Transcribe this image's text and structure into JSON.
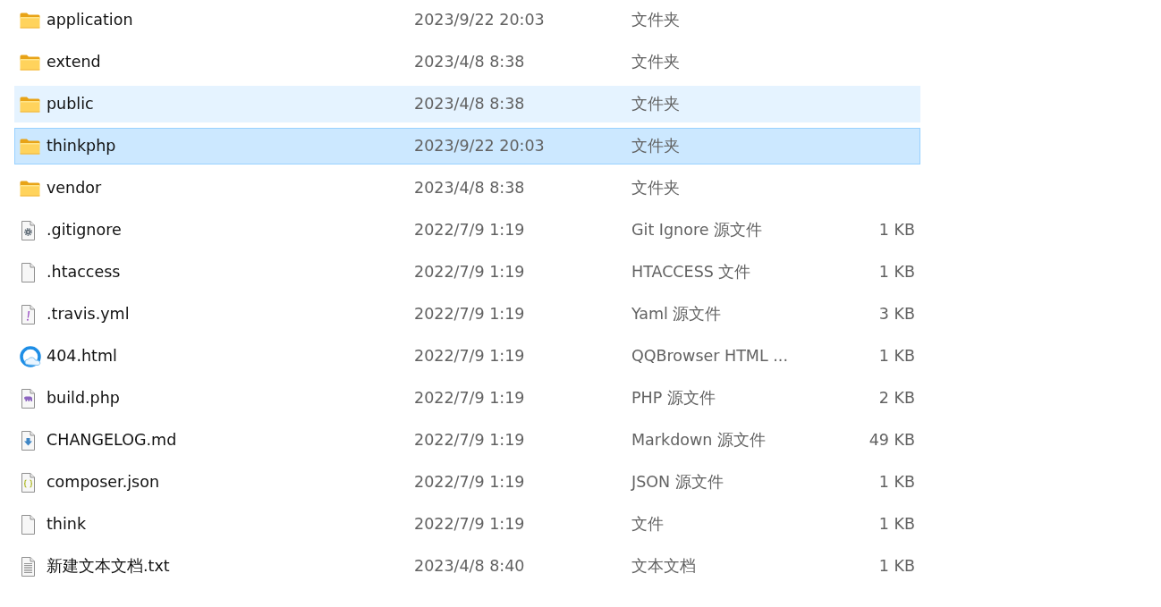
{
  "rows": [
    {
      "kind": "folder",
      "name": "application",
      "modified": "2023/9/22 20:03",
      "type": "文件夹",
      "selected": false,
      "hovered": false
    },
    {
      "kind": "folder",
      "name": "extend",
      "modified": "2023/4/8 8:38",
      "type": "文件夹",
      "selected": false,
      "hovered": false
    },
    {
      "kind": "folder",
      "name": "public",
      "modified": "2023/4/8 8:38",
      "type": "文件夹",
      "selected": false,
      "hovered": true
    },
    {
      "kind": "folder",
      "name": "thinkphp",
      "modified": "2023/9/22 20:03",
      "type": "文件夹",
      "selected": true,
      "hovered": false
    },
    {
      "kind": "folder",
      "name": "vendor",
      "modified": "2023/4/8 8:38",
      "type": "文件夹",
      "selected": false,
      "hovered": false
    },
    {
      "kind": "settings",
      "name": ".gitignore",
      "modified": "2022/7/9 1:19",
      "type": "Git Ignore 源文件",
      "size": "1 KB",
      "selected": false,
      "hovered": false
    },
    {
      "kind": "blank",
      "name": ".htaccess",
      "modified": "2022/7/9 1:19",
      "type": "HTACCESS 文件",
      "size": "1 KB",
      "selected": false,
      "hovered": false
    },
    {
      "kind": "yaml",
      "name": ".travis.yml",
      "modified": "2022/7/9 1:19",
      "type": "Yaml 源文件",
      "size": "3 KB",
      "selected": false,
      "hovered": false
    },
    {
      "kind": "browser",
      "name": "404.html",
      "modified": "2022/7/9 1:19",
      "type": "QQBrowser HTML ...",
      "size": "1 KB",
      "selected": false,
      "hovered": false
    },
    {
      "kind": "php",
      "name": "build.php",
      "modified": "2022/7/9 1:19",
      "type": "PHP 源文件",
      "size": "2 KB",
      "selected": false,
      "hovered": false
    },
    {
      "kind": "markdown",
      "name": "CHANGELOG.md",
      "modified": "2022/7/9 1:19",
      "type": "Markdown 源文件",
      "size": "49 KB",
      "selected": false,
      "hovered": false
    },
    {
      "kind": "json",
      "name": "composer.json",
      "modified": "2022/7/9 1:19",
      "type": "JSON 源文件",
      "size": "1 KB",
      "selected": false,
      "hovered": false
    },
    {
      "kind": "blank",
      "name": "think",
      "modified": "2022/7/9 1:19",
      "type": "文件",
      "size": "1 KB",
      "selected": false,
      "hovered": false
    },
    {
      "kind": "text",
      "name": "新建文本文档.txt",
      "modified": "2023/4/8 8:40",
      "type": "文本文档",
      "size": "1 KB",
      "selected": false,
      "hovered": false
    }
  ]
}
